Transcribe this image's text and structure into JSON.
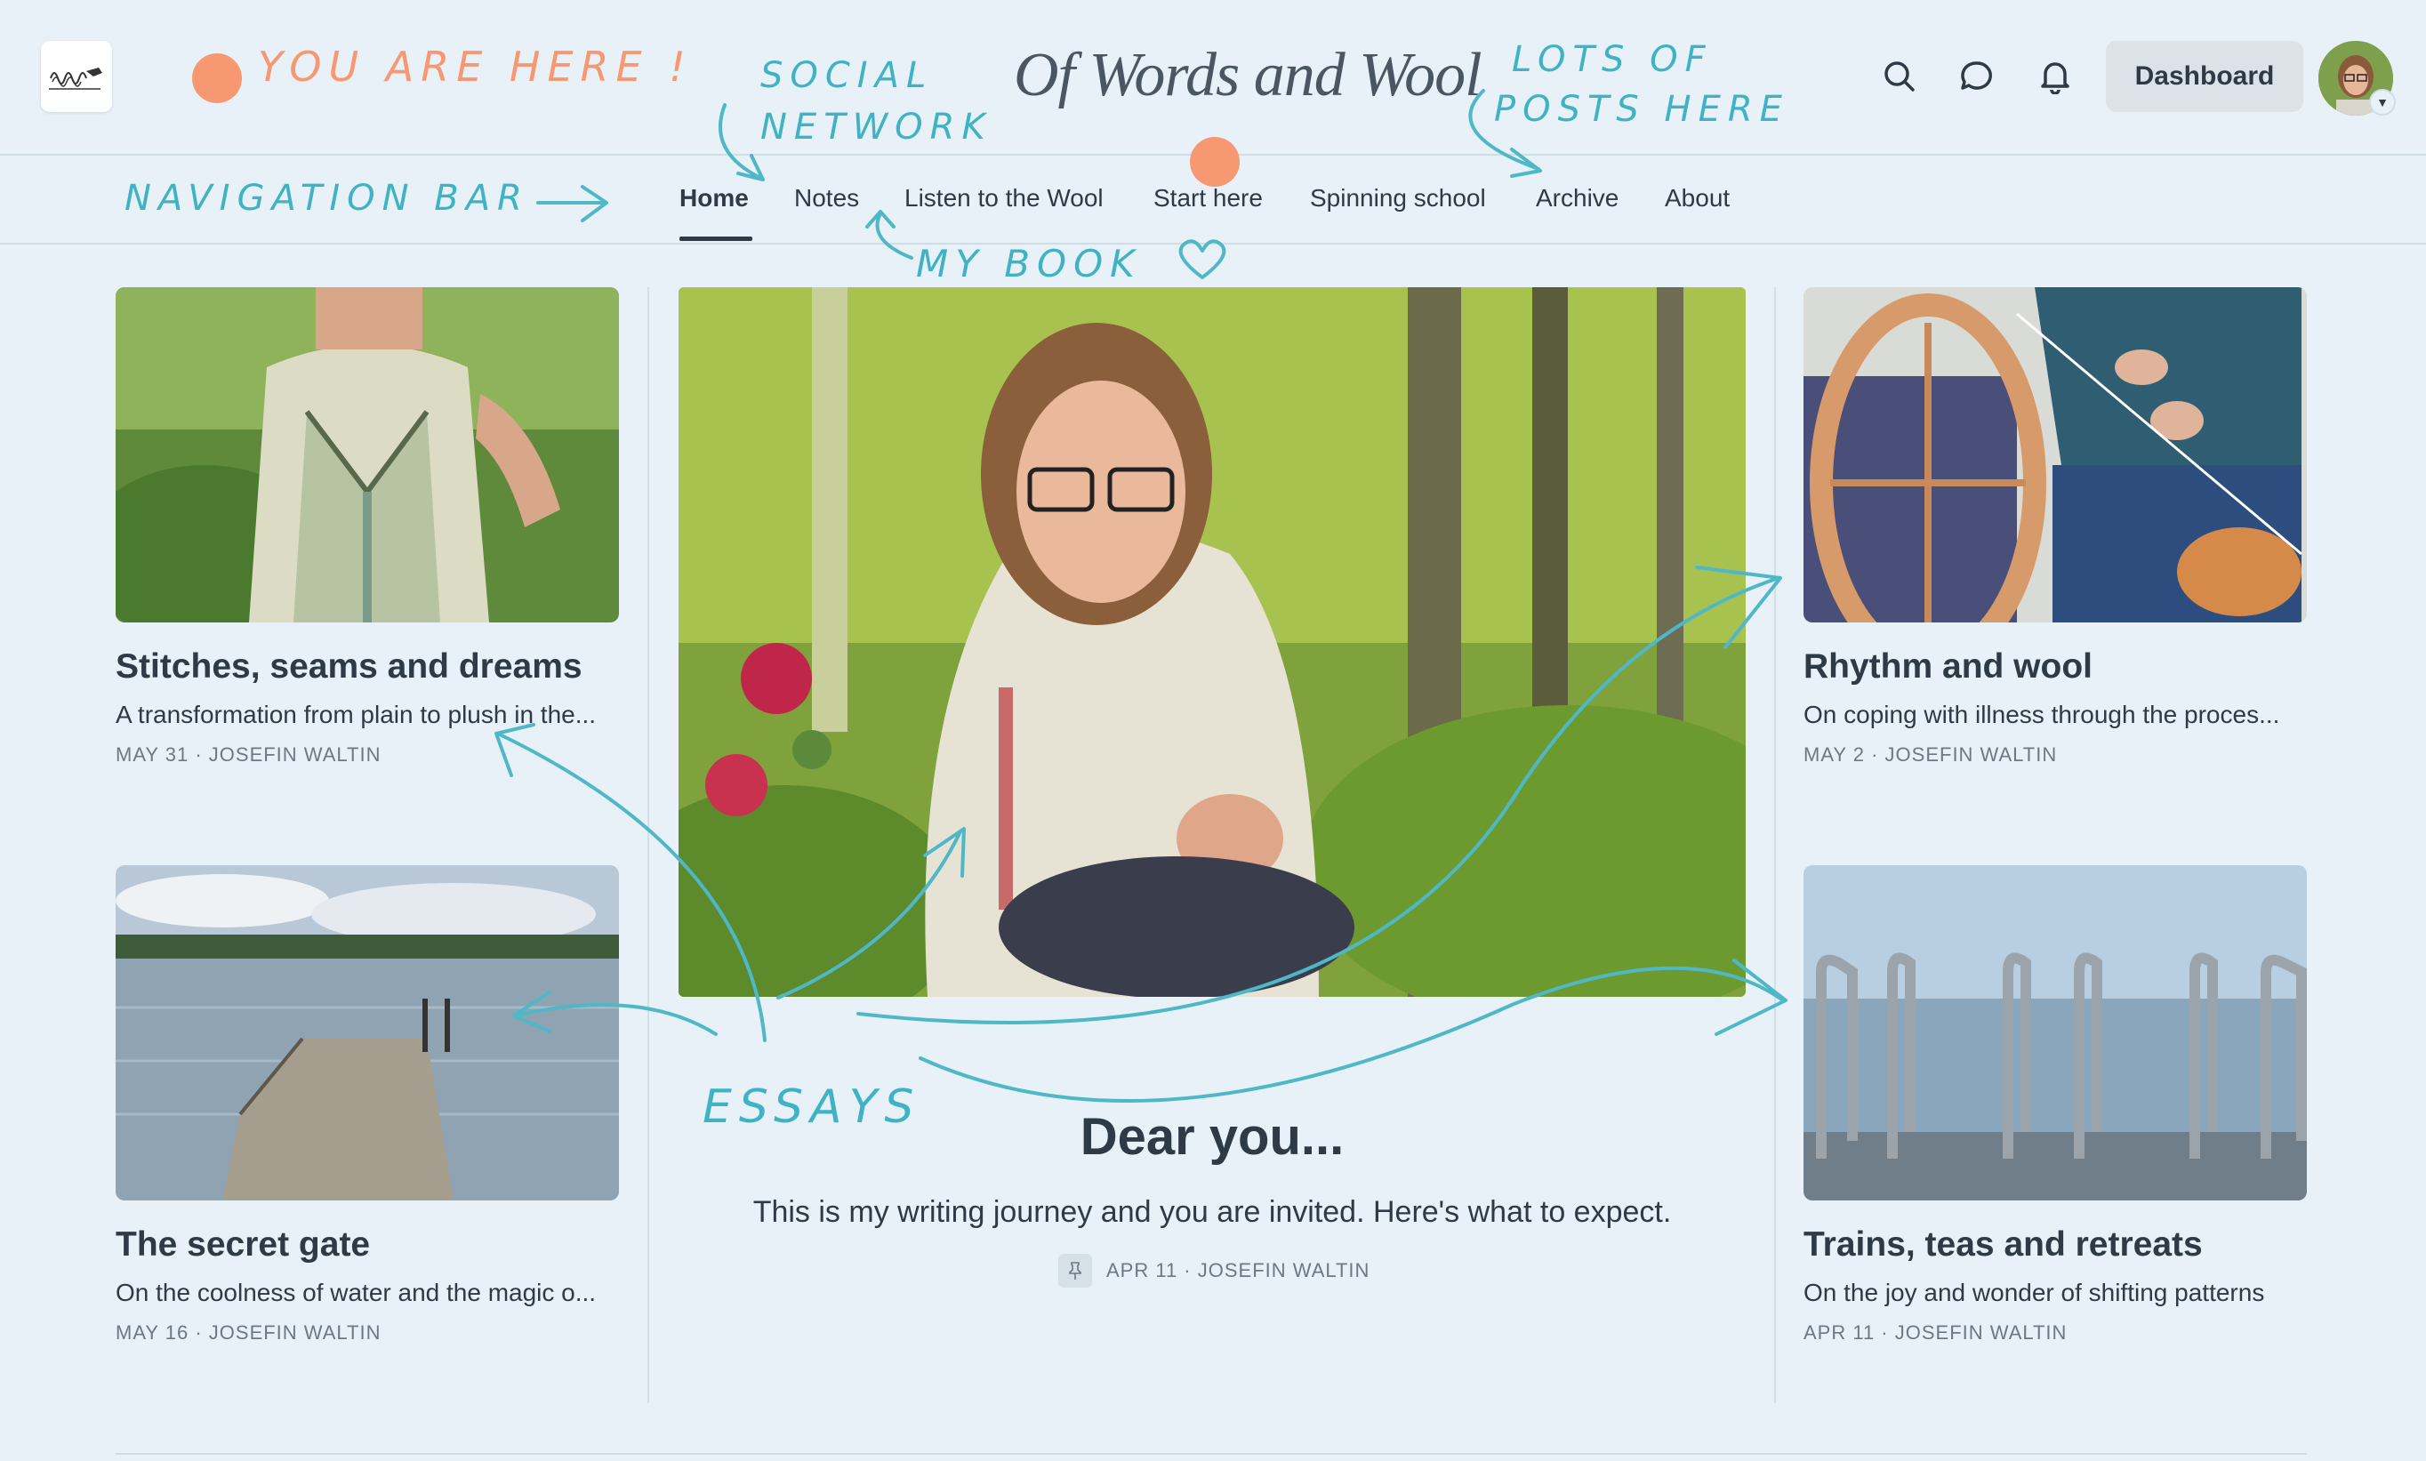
{
  "header": {
    "site_title": "Of Words and Wool",
    "dashboard_label": "Dashboard",
    "icons": [
      "logo-icon",
      "search-icon",
      "chat-icon",
      "bell-icon",
      "chevron-down-icon"
    ]
  },
  "nav": {
    "items": [
      {
        "label": "Home",
        "active": true
      },
      {
        "label": "Notes"
      },
      {
        "label": "Listen to the Wool"
      },
      {
        "label": "Start here"
      },
      {
        "label": "Spinning school"
      },
      {
        "label": "Archive"
      },
      {
        "label": "About"
      }
    ]
  },
  "posts": {
    "left_top": {
      "title": "Stitches, seams and dreams",
      "subtitle": "A transformation from plain to plush in the...",
      "meta": "MAY 31 · JOSEFIN WALTIN"
    },
    "left_bottom": {
      "title": "The secret gate",
      "subtitle": "On the coolness of water and the magic o...",
      "meta": "MAY 16 · JOSEFIN WALTIN"
    },
    "right_top": {
      "title": "Rhythm and wool",
      "subtitle": "On coping with illness through the proces...",
      "meta": "MAY 2 · JOSEFIN WALTIN"
    },
    "right_bottom": {
      "title": "Trains, teas and retreats",
      "subtitle": "On the joy and wonder of shifting patterns",
      "meta": "APR 11 · JOSEFIN WALTIN"
    },
    "hero": {
      "title": "Dear you...",
      "subtitle": "This is my writing journey and you are invited. Here's what to expect.",
      "meta": "APR 11 · JOSEFIN WALTIN"
    }
  },
  "annotations": {
    "you_are_here": "YOU ARE HERE !",
    "social_line1": "SOCIAL",
    "social_line2": "NETWORK",
    "lots_line1": "LOTS OF",
    "lots_line2": "POSTS HERE",
    "navigation_bar": "NAVIGATION BAR",
    "my_book": "MY BOOK",
    "essays": "ESSAYS"
  },
  "colors": {
    "background": "#e8f1f7",
    "annotation_teal": "#3fb3c4",
    "annotation_orange": "#f79873",
    "text": "#2e3a45"
  }
}
